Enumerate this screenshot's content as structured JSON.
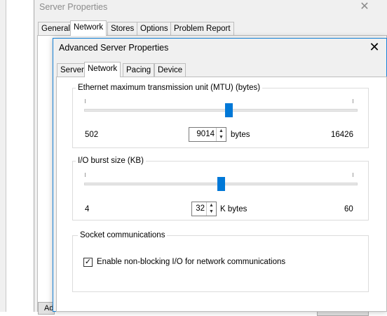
{
  "parent_window": {
    "title": "Server Properties",
    "tabs": [
      "General",
      "Network",
      "Stores",
      "Options",
      "Problem Report"
    ],
    "active_tab": "Network",
    "bottom_button_label": "Ad"
  },
  "dialog": {
    "title": "Advanced Server Properties",
    "tabs": [
      "Server",
      "Network",
      "Pacing",
      "Device"
    ],
    "active_tab": "Network",
    "mtu": {
      "group_label": "Ethernet maximum transmission unit (MTU) (bytes)",
      "min_label": "502",
      "max_label": "16426",
      "value": "9014",
      "unit": "bytes",
      "slider_fraction": 0.53
    },
    "burst": {
      "group_label": "I/O burst size (KB)",
      "min_label": "4",
      "max_label": "60",
      "value": "32",
      "unit": "K bytes",
      "slider_fraction": 0.5
    },
    "socket": {
      "group_label": "Socket communications",
      "checkbox_label": "Enable non-blocking I/O for network communications",
      "checked": true
    }
  }
}
